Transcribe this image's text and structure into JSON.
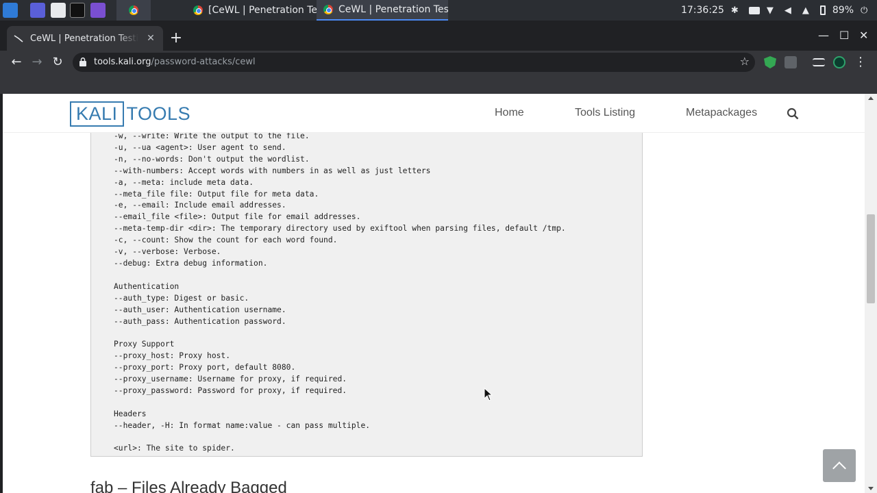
{
  "taskbar": {
    "windows": [
      {
        "label": "[CeWL | Penetration Tes..."
      },
      {
        "label": "CeWL | Penetration Test..."
      }
    ],
    "clock": "17:36:25",
    "battery": "89%"
  },
  "browser": {
    "tab_title": "CeWL | Penetration Testing",
    "url_host": "tools.kali.org",
    "url_path": "/password-attacks/cewl"
  },
  "site": {
    "logo_left": "KALI",
    "logo_right": "TOOLS",
    "nav": [
      "Home",
      "Tools Listing",
      "Metapackages"
    ]
  },
  "code_lines": "-w, --write: Write the output to the file.\n-u, --ua <agent>: User agent to send.\n-n, --no-words: Don't output the wordlist.\n--with-numbers: Accept words with numbers in as well as just letters\n-a, --meta: include meta data.\n--meta_file file: Output file for meta data.\n-e, --email: Include email addresses.\n--email_file <file>: Output file for email addresses.\n--meta-temp-dir <dir>: The temporary directory used by exiftool when parsing files, default /tmp.\n-c, --count: Show the count for each word found.\n-v, --verbose: Verbose.\n--debug: Extra debug information.\n\nAuthentication\n--auth_type: Digest or basic.\n--auth_user: Authentication username.\n--auth_pass: Authentication password.\n\nProxy Support\n--proxy_host: Proxy host.\n--proxy_port: Proxy port, default 8080.\n--proxy_username: Username for proxy, if required.\n--proxy_password: Password for proxy, if required.\n\nHeaders\n--header, -H: In format name:value - can pass multiple.\n\n<url>: The site to spider.",
  "next_heading": "fab – Files Already Bagged",
  "colors": {
    "accent": "#367bb0",
    "code_bg": "#f0f0f0"
  }
}
